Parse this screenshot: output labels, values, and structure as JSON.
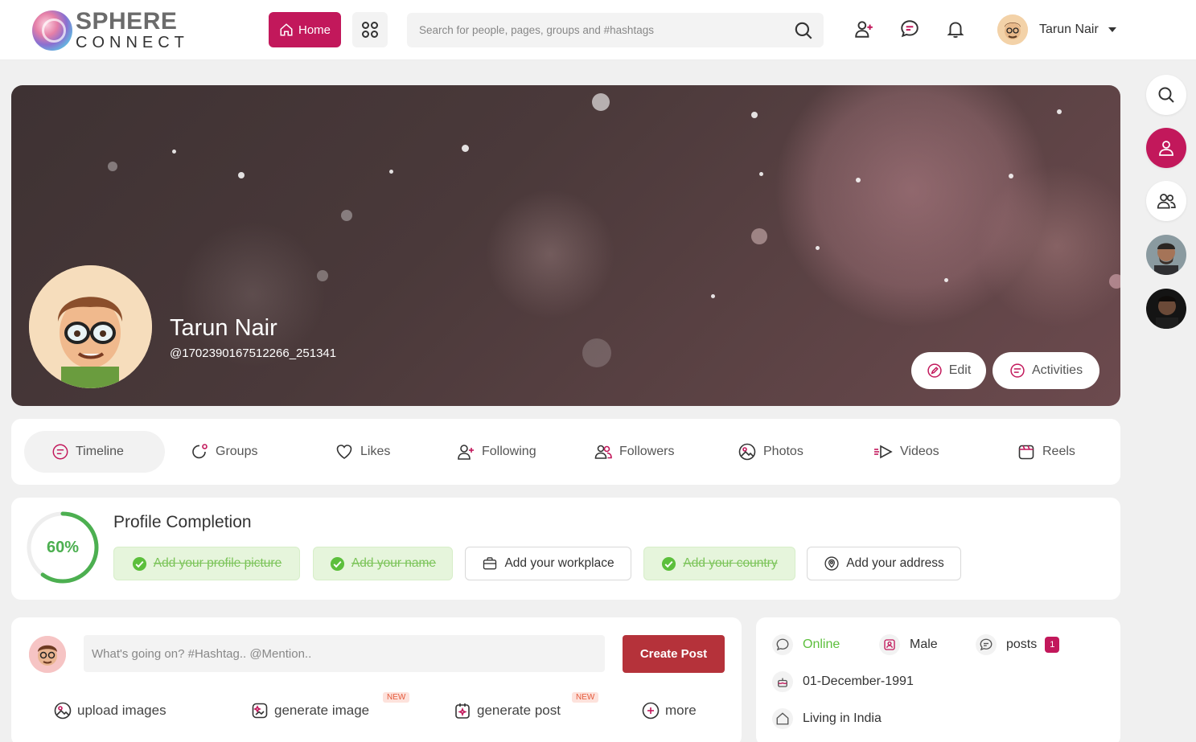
{
  "brand": {
    "line1": "SPHERE",
    "line2": "CONNECT"
  },
  "header": {
    "home_label": "Home",
    "search_placeholder": "Search for people, pages, groups and #hashtags",
    "user_name": "Tarun Nair"
  },
  "profile": {
    "name": "Tarun Nair",
    "handle": "@1702390167512266_251341",
    "edit_label": "Edit",
    "activities_label": "Activities"
  },
  "tabs": [
    {
      "label": "Timeline",
      "active": true
    },
    {
      "label": "Groups"
    },
    {
      "label": "Likes"
    },
    {
      "label": "Following"
    },
    {
      "label": "Followers"
    },
    {
      "label": "Photos"
    },
    {
      "label": "Videos"
    },
    {
      "label": "Reels"
    }
  ],
  "completion": {
    "title": "Profile Completion",
    "percent_label": "60%",
    "percent": 0.6,
    "steps": [
      {
        "label": "Add your profile picture",
        "done": true
      },
      {
        "label": "Add your name",
        "done": true
      },
      {
        "label": "Add your workplace",
        "done": false
      },
      {
        "label": "Add your country",
        "done": true
      },
      {
        "label": "Add your address",
        "done": false
      }
    ]
  },
  "composer": {
    "placeholder": "What's going on? #Hashtag.. @Mention..",
    "create_label": "Create Post",
    "actions": [
      {
        "label": "upload images"
      },
      {
        "label": "generate image",
        "badge": "NEW"
      },
      {
        "label": "generate post",
        "badge": "NEW"
      },
      {
        "label": "more"
      }
    ]
  },
  "info": {
    "status": "Online",
    "gender": "Male",
    "posts_label": "posts",
    "posts_count": "1",
    "birthday": "01-December-1991",
    "location": "Living in India"
  },
  "colors": {
    "accent": "#c2185b",
    "create_button": "#b5323a",
    "success": "#4caf50"
  }
}
